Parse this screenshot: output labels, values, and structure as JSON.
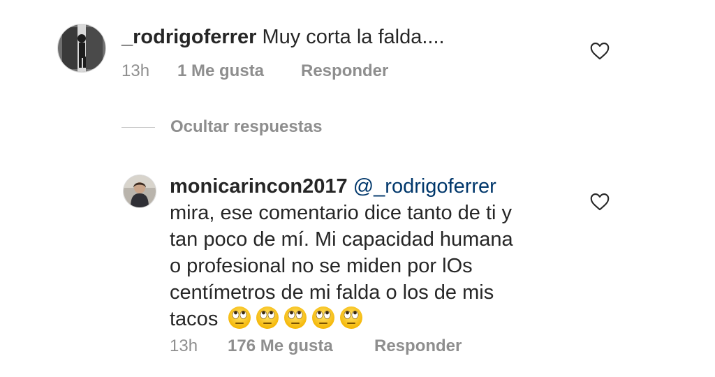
{
  "comments": [
    {
      "username": "_rodrigoferrer",
      "text": "Muy corta la falda....",
      "time": "13h",
      "likes": "1 Me gusta",
      "reply_label": "Responder"
    }
  ],
  "hide_replies_label": "Ocultar respuestas",
  "reply": {
    "username": "monicarincon2017",
    "mention": "@_rodrigoferrer",
    "lines": [
      "mira, ese comentario dice tanto de ti y",
      "tan poco de mí. Mi capacidad humana",
      "o profesional no se miden por lOs",
      "centímetros de mi falda o los de mis",
      "tacos"
    ],
    "emoji_count": 5,
    "emoji_name": "face-with-rolling-eyes",
    "time": "13h",
    "likes": "176 Me gusta",
    "reply_label": "Responder"
  },
  "icons": {
    "like": "heart-outline-icon"
  },
  "colors": {
    "text": "#262626",
    "muted": "#8e8e8e",
    "mention": "#00376b",
    "divider": "#c7c7c7"
  }
}
